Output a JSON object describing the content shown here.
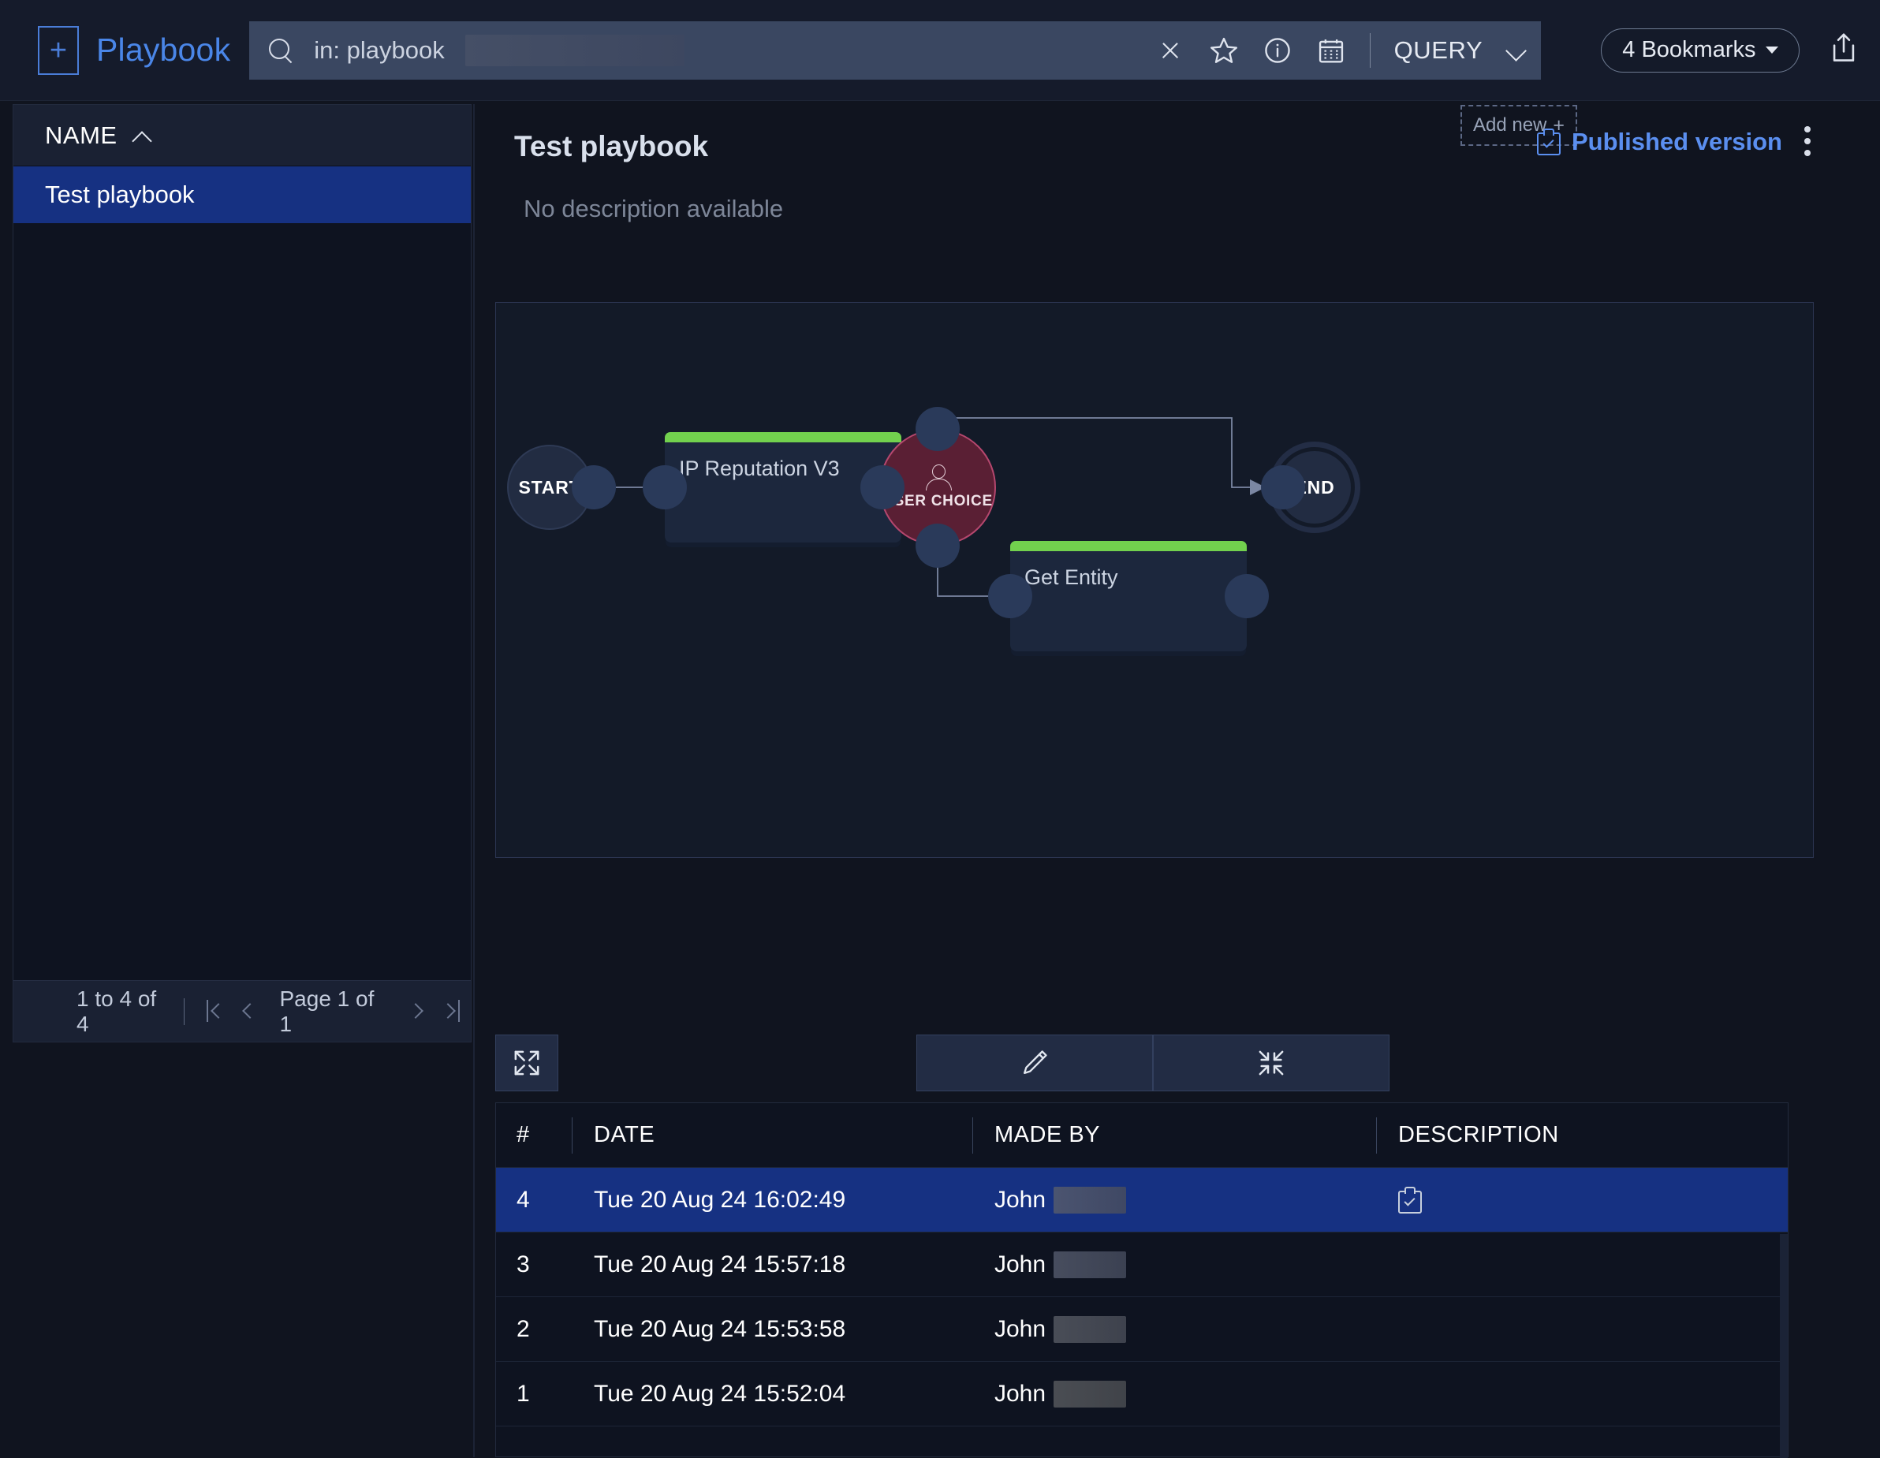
{
  "app": {
    "title": "Playbook",
    "new_icon": "plus-icon"
  },
  "search": {
    "icon": "search-icon",
    "prefix": "in: playbook",
    "value_redacted": true,
    "clear_icon": "close-icon",
    "star_icon": "star-icon",
    "info_icon": "info-icon",
    "calendar_icon": "calendar-icon",
    "mode_label": "QUERY",
    "mode_chevron": "chevron-down-icon"
  },
  "toolbar": {
    "bookmarks_label": "4 Bookmarks",
    "bookmarks_caret": "caret-down-icon",
    "share_icon": "share-icon",
    "settings_icon": "sliders-icon"
  },
  "sidebar": {
    "header": "NAME",
    "sort_icon": "caret-up-icon",
    "items": [
      {
        "label": "Test playbook",
        "selected": true
      }
    ],
    "pagination": {
      "range": "1 to 4 of 4",
      "page": "Page 1 of 1",
      "first_icon": "first-page-icon",
      "prev_icon": "prev-page-icon",
      "next_icon": "next-page-icon",
      "last_icon": "last-page-icon"
    }
  },
  "main": {
    "title": "Test playbook",
    "add_new_label": "Add new",
    "add_new_plus": "+",
    "published_label": "Published version",
    "published_icon": "clipboard-check-icon",
    "kebab_icon": "more-vertical-icon",
    "description": "No description available"
  },
  "canvas": {
    "nodes": [
      {
        "id": "start",
        "label": "START",
        "type": "terminal-start"
      },
      {
        "id": "ip_rep",
        "label": "IP Reputation V3",
        "type": "action",
        "accent": "#72d14e"
      },
      {
        "id": "user_choice",
        "label": "USER CHOICE",
        "type": "choice",
        "icon": "user-icon",
        "accent": "#b5476e"
      },
      {
        "id": "get_entity",
        "label": "Get Entity",
        "type": "action",
        "accent": "#72d14e"
      },
      {
        "id": "end",
        "label": "END",
        "type": "terminal-end"
      }
    ],
    "edges": [
      {
        "from": "start",
        "to": "ip_rep"
      },
      {
        "from": "ip_rep",
        "to": "user_choice"
      },
      {
        "from": "user_choice",
        "to": "end"
      },
      {
        "from": "user_choice",
        "to": "get_entity"
      },
      {
        "from": "get_entity",
        "to": "end"
      }
    ],
    "toolbar": {
      "expand_icon": "expand-arrows-icon",
      "edit_icon": "pencil-icon",
      "collapse_icon": "collapse-arrows-icon"
    }
  },
  "history": {
    "columns": [
      "#",
      "DATE",
      "MADE BY",
      "DESCRIPTION"
    ],
    "rows": [
      {
        "num": "4",
        "date": "Tue 20 Aug 24 16:02:49",
        "made_by": "John",
        "made_by_redacted": true,
        "description_icon": "clipboard-check-icon",
        "selected": true
      },
      {
        "num": "3",
        "date": "Tue 20 Aug 24 15:57:18",
        "made_by": "John",
        "made_by_redacted": true,
        "description_icon": "",
        "selected": false
      },
      {
        "num": "2",
        "date": "Tue 20 Aug 24 15:53:58",
        "made_by": "John",
        "made_by_redacted": true,
        "description_icon": "",
        "selected": false
      },
      {
        "num": "1",
        "date": "Tue 20 Aug 24 15:52:04",
        "made_by": "John",
        "made_by_redacted": true,
        "description_icon": "",
        "selected": false
      }
    ]
  },
  "colors": {
    "accent_blue": "#4a86e8",
    "selection_blue": "#163182",
    "node_green": "#72d14e",
    "choice_red": "#b5476e",
    "background": "#10141f",
    "panel": "#0e1320"
  }
}
